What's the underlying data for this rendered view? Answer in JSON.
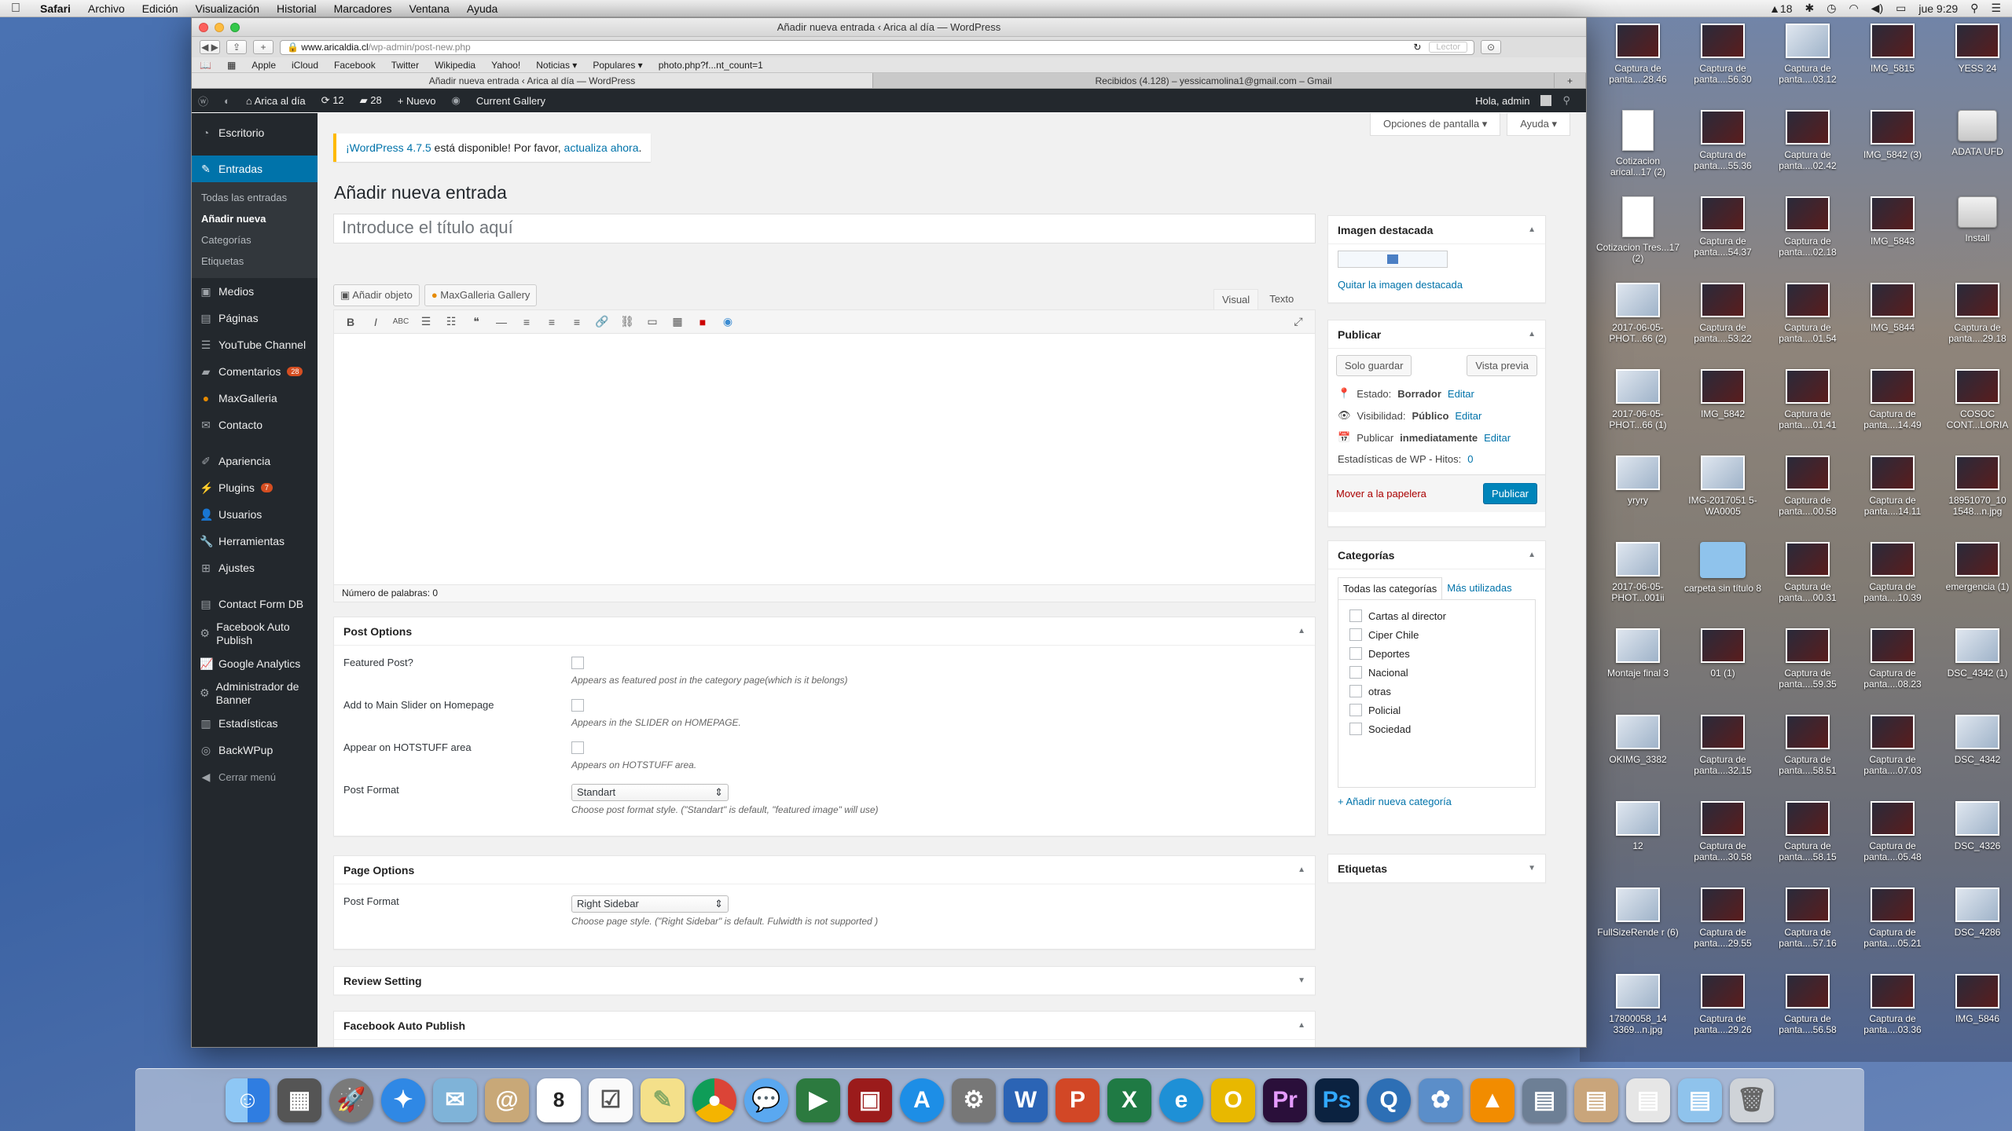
{
  "menubar": {
    "app": "Safari",
    "items": [
      "Archivo",
      "Edición",
      "Visualización",
      "Historial",
      "Marcadores",
      "Ventana",
      "Ayuda"
    ],
    "status": {
      "battery_count": "18",
      "clock": "jue 9:29"
    }
  },
  "browser": {
    "window_title": "Añadir nueva entrada ‹ Arica al día — WordPress",
    "url_host": "www.aricaldia.cl",
    "url_path": "/wp-admin/post-new.php",
    "reader_label": "Lector",
    "bookmarks": [
      "Apple",
      "iCloud",
      "Facebook",
      "Twitter",
      "Wikipedia",
      "Yahoo!",
      "Noticias ▾",
      "Populares ▾",
      "photo.php?f...nt_count=1"
    ],
    "tabs": [
      "Añadir nueva entrada ‹ Arica al día — WordPress",
      "Recibidos (4.128) – yessicamolina1@gmail.com – Gmail"
    ]
  },
  "adminbar": {
    "site": "Arica al día",
    "updates": "12",
    "comments": "28",
    "new": "Nuevo",
    "gallery": "Current Gallery",
    "greeting": "Hola, admin"
  },
  "menu": {
    "escritorio": "Escritorio",
    "entradas": "Entradas",
    "sub": [
      "Todas las entradas",
      "Añadir nueva",
      "Categorías",
      "Etiquetas"
    ],
    "items": [
      "Medios",
      "Páginas",
      "YouTube Channel",
      "Comentarios",
      "MaxGalleria",
      "Contacto"
    ],
    "comments_badge": "28",
    "items2": [
      "Apariencia",
      "Plugins",
      "Usuarios",
      "Herramientas",
      "Ajustes"
    ],
    "plugins_badge": "7",
    "items3": [
      "Contact Form DB",
      "Facebook Auto Publish",
      "Google Analytics",
      "Administrador de Banner",
      "Estadísticas",
      "BackWPup",
      "Cerrar menú"
    ]
  },
  "page": {
    "screen_options": "Opciones de pantalla ▾",
    "help": "Ayuda ▾",
    "notice_prefix_link": "¡WordPress 4.7.5",
    "notice_text": " está disponible! Por favor, ",
    "notice_action": "actualiza ahora",
    "notice_end": ".",
    "heading": "Añadir nueva entrada",
    "title_placeholder": "Introduce el título aquí",
    "add_media": "Añadir objeto",
    "maxgalleria": "MaxGalleria Gallery",
    "tab_visual": "Visual",
    "tab_text": "Texto",
    "word_count": "Número de palabras: 0"
  },
  "post_options": {
    "title": "Post Options",
    "featured_label": "Featured Post?",
    "featured_desc": "Appears as featured post in the category page(which is it belongs)",
    "slider_label": "Add to Main Slider on Homepage",
    "slider_desc": "Appears in the SLIDER on HOMEPAGE.",
    "hotstuff_label": "Appear on HOTSTUFF area",
    "hotstuff_desc": "Appears on HOTSTUFF area.",
    "format_label": "Post Format",
    "format_value": "Standart",
    "format_desc": "Choose post format style. (\"Standart\" is default, \"featured image\" will use)"
  },
  "page_options": {
    "title": "Page Options",
    "format_label": "Post Format",
    "format_value": "Right Sidebar",
    "format_desc": "Choose page style. (\"Right Sidebar\" is default. Fulwidth is not supported )"
  },
  "review": {
    "title": "Review Setting"
  },
  "fb_auto": {
    "title": "Facebook Auto Publish"
  },
  "featured_image": {
    "title": "Imagen destacada",
    "remove": "Quitar la imagen destacada"
  },
  "publish": {
    "title": "Publicar",
    "save": "Solo guardar",
    "preview": "Vista previa",
    "status_label": "Estado: ",
    "status_value": "Borrador",
    "visibility_label": "Visibilidad: ",
    "visibility_value": "Público",
    "schedule_label": "Publicar ",
    "schedule_value": "inmediatamente",
    "edit": "Editar",
    "stats_label": "Estadísticas de WP - Hitos: ",
    "stats_value": "0",
    "trash": "Mover a la papelera",
    "publish": "Publicar"
  },
  "categories": {
    "title": "Categorías",
    "tab_all": "Todas las categorías",
    "tab_popular": "Más utilizadas",
    "list": [
      "Cartas al director",
      "Ciper Chile",
      "Deportes",
      "Nacional",
      "otras",
      "Policial",
      "Sociedad"
    ],
    "add": "+ Añadir nueva categoría"
  },
  "tags": {
    "title": "Etiquetas"
  },
  "desktop_icons": [
    "Captura de panta....28.46",
    "Captura de panta....56.30",
    "Captura de panta....03.12",
    "IMG_5815",
    "YESS 24",
    "Cotizacion arical...17 (2)",
    "Captura de panta....55.36",
    "Captura de panta....02.42",
    "IMG_5842 (3)",
    "ADATA UFD",
    "Cotizacion Tres...17 (2)",
    "Captura de panta....54.37",
    "Captura de panta....02.18",
    "IMG_5843",
    "Install",
    "2017-06-05-PHOT...66 (2)",
    "Captura de panta....53.22",
    "Captura de panta....01.54",
    "IMG_5844",
    "Captura de panta....29.18",
    "2017-06-05-PHOT...66 (1)",
    "IMG_5842",
    "Captura de panta....01.41",
    "Captura de panta....14.49",
    "COSOC CONT...LORIA",
    "yryry",
    "IMG-2017051 5-WA0005",
    "Captura de panta....00.58",
    "Captura de panta....14.11",
    "18951070_10 1548...n.jpg",
    "2017-06-05-PHOT...001ii",
    "carpeta sin título 8",
    "Captura de panta....00.31",
    "Captura de panta....10.39",
    "emergencia (1)",
    "Montaje final 3",
    "01 (1)",
    "Captura de panta....59.35",
    "Captura de panta....08.23",
    "DSC_4342 (1)",
    "OKIMG_3382",
    "Captura de panta....32.15",
    "Captura de panta....58.51",
    "Captura de panta....07.03",
    "DSC_4342",
    "12",
    "Captura de panta....30.58",
    "Captura de panta....58.15",
    "Captura de panta....05.48",
    "DSC_4326",
    "FullSizeRende r (6)",
    "Captura de panta....29.55",
    "Captura de panta....57.16",
    "Captura de panta....05.21",
    "DSC_4286",
    "17800058_14 3369...n.jpg",
    "Captura de panta....29.26",
    "Captura de panta....56.58",
    "Captura de panta....03.36",
    "IMG_5846"
  ],
  "dock": {
    "word_letter": "W",
    "premiere_letters": "Pr",
    "photoshop_letters": "Ps",
    "calendar_day": "8"
  }
}
